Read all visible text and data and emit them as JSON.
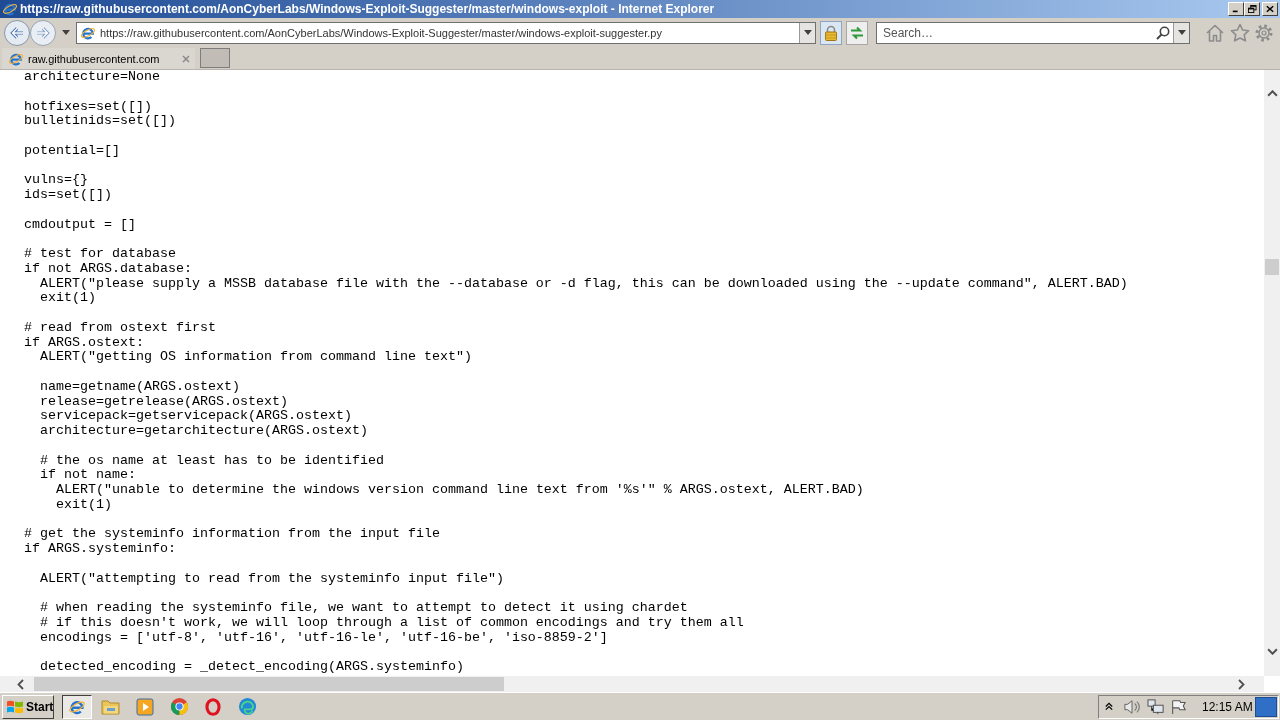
{
  "window": {
    "title": "https://raw.githubusercontent.com/AonCyberLabs/Windows-Exploit-Suggester/master/windows-exploit - Internet Explorer"
  },
  "address_bar": {
    "url": "https://raw.githubusercontent.com/AonCyberLabs/Windows-Exploit-Suggester/master/windows-exploit-suggester.py"
  },
  "search": {
    "placeholder": "Search…"
  },
  "tabs": [
    {
      "label": "raw.githubusercontent.com",
      "selected": true
    }
  ],
  "code_blocks": [
    [
      "architecture=None"
    ],
    [
      "hotfixes=set([])",
      "bulletinids=set([])"
    ],
    [
      "potential=[]"
    ],
    [
      "vulns={}",
      "ids=set([])"
    ],
    [
      "cmdoutput = []"
    ],
    [
      "# test for database",
      "if not ARGS.database:",
      "  ALERT(\"please supply a MSSB database file with the --database or -d flag, this can be downloaded using the --update command\", ALERT.BAD)",
      "  exit(1)"
    ],
    [
      "# read from ostext first",
      "if ARGS.ostext:",
      "  ALERT(\"getting OS information from command line text\")"
    ],
    [
      "  name=getname(ARGS.ostext)",
      "  release=getrelease(ARGS.ostext)",
      "  servicepack=getservicepack(ARGS.ostext)",
      "  architecture=getarchitecture(ARGS.ostext)"
    ],
    [
      "  # the os name at least has to be identified",
      "  if not name:",
      "    ALERT(\"unable to determine the windows version command line text from '%s'\" % ARGS.ostext, ALERT.BAD)",
      "    exit(1)"
    ],
    [
      "# get the systeminfo information from the input file",
      "if ARGS.systeminfo:"
    ],
    [
      "  ALERT(\"attempting to read from the systeminfo input file\")"
    ],
    [
      "  # when reading the systeminfo file, we want to attempt to detect it using chardet",
      "  # if this doesn't work, we will loop through a list of common encodings and try them all",
      "  encodings = ['utf-8', 'utf-16', 'utf-16-le', 'utf-16-be', 'iso-8859-2']"
    ],
    [
      "  detected_encoding = _detect_encoding(ARGS.systeminfo)"
    ]
  ],
  "taskbar": {
    "start_label": "Start",
    "apps": [
      {
        "kind": "globe",
        "selected": true
      },
      {
        "kind": "folder",
        "selected": false
      },
      {
        "kind": "player",
        "selected": false
      },
      {
        "kind": "ring",
        "selected": false
      },
      {
        "kind": "oval",
        "selected": false
      },
      {
        "kind": "swirl",
        "selected": false
      }
    ],
    "clock": "12:15 AM"
  }
}
